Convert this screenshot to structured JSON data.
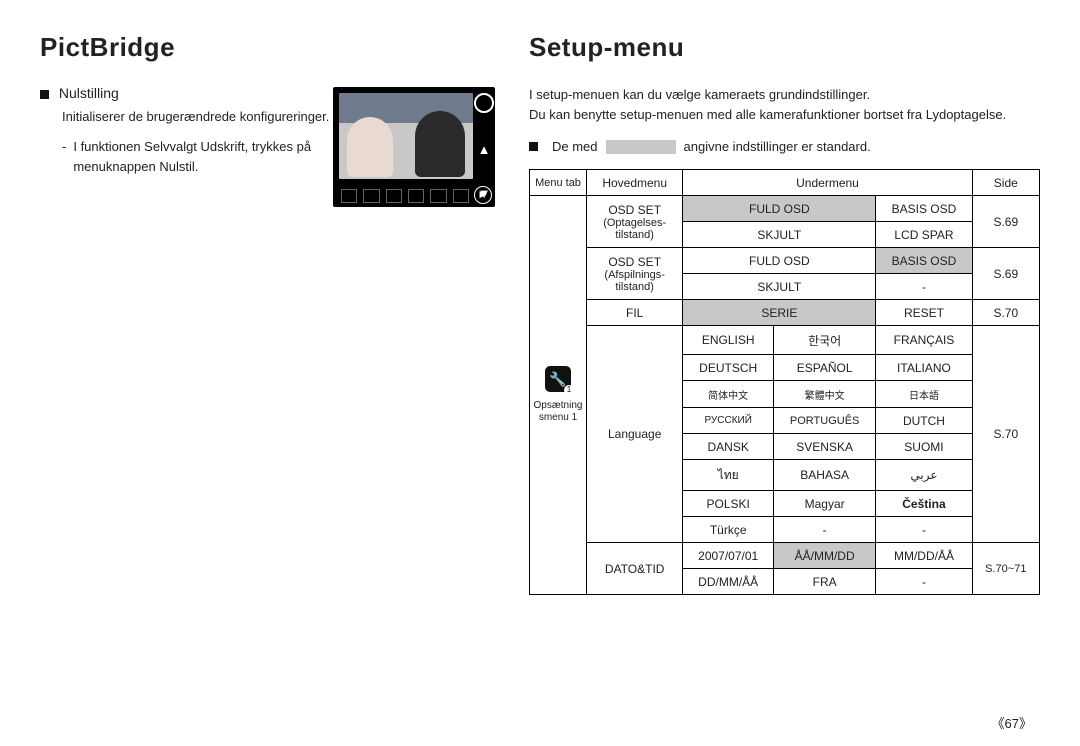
{
  "left": {
    "title": "PictBridge",
    "section": "Nulstilling",
    "desc": "Initialiserer de brugerændrede konfigureringer.",
    "bullet_dash": "-",
    "bullet": "I funktionen Selvvalgt Udskrift, trykkes på menuknappen Nulstil."
  },
  "right": {
    "title": "Setup-menu",
    "intro1": "I setup-menuen kan du vælge kameraets grundindstillinger.",
    "intro2": "Du kan benytte setup-menuen med alle kamerafunktioner bortset fra Lydoptagelse.",
    "de_med_prefix": "De med",
    "de_med_suffix": "angivne indstillinger er standard.",
    "headers": {
      "menutab": "Menu tab",
      "hoved": "Hovedmenu",
      "under": "Undermenu",
      "side": "Side"
    },
    "menutab_label1": "Opsætning",
    "menutab_label2": "smenu 1",
    "osd1_main1": "OSD SET",
    "osd1_main2": "(Optagelses-",
    "osd1_main3": "tilstand)",
    "osd1_r1c1": "FULD OSD",
    "osd1_r1c2": "BASIS OSD",
    "osd1_r2c1": "SKJULT",
    "osd1_r2c2": "LCD SPAR",
    "osd_side": "S.69",
    "osd2_main1": "OSD SET",
    "osd2_main2": "(Afspilnings-",
    "osd2_main3": "tilstand)",
    "osd2_r1c1": "FULD OSD",
    "osd2_r1c2": "BASIS OSD",
    "osd2_r2c1": "SKJULT",
    "osd2_r2c2": "-",
    "fil_main": "FIL",
    "fil_c1": "SERIE",
    "fil_c2": "RESET",
    "fil_side": "S.70",
    "lang_main": "Language",
    "lang": {
      "r1c1": "ENGLISH",
      "r1c2": "한국어",
      "r1c3": "FRANÇAIS",
      "r2c1": "DEUTSCH",
      "r2c2": "ESPAÑOL",
      "r2c3": "ITALIANO",
      "r3c1": "简体中文",
      "r3c2": "繁體中文",
      "r3c3": "日本語",
      "r4c1": "РУССКИЙ",
      "r4c2": "PORTUGUÊS",
      "r4c3": "DUTCH",
      "r5c1": "DANSK",
      "r5c2": "SVENSKA",
      "r5c3": "SUOMI",
      "r6c1": "ไทย",
      "r6c2": "BAHASA",
      "r6c3": "عربي",
      "r7c1": "POLSKI",
      "r7c2": "Magyar",
      "r7c3": "Čeština",
      "r8c1": "Türkçe",
      "r8c2": "-",
      "r8c3": "-"
    },
    "lang_side": "S.70",
    "date_main": "DATO&TID",
    "date": {
      "r1c1": "2007/07/01",
      "r1c2": "ÅÅ/MM/DD",
      "r1c3": "MM/DD/ÅÅ",
      "r2c1": "DD/MM/ÅÅ",
      "r2c2": "FRA",
      "r2c3": "-"
    },
    "date_side": "S.70~71"
  },
  "icons": {
    "wrench": "🔧"
  },
  "page_number": "《67》"
}
